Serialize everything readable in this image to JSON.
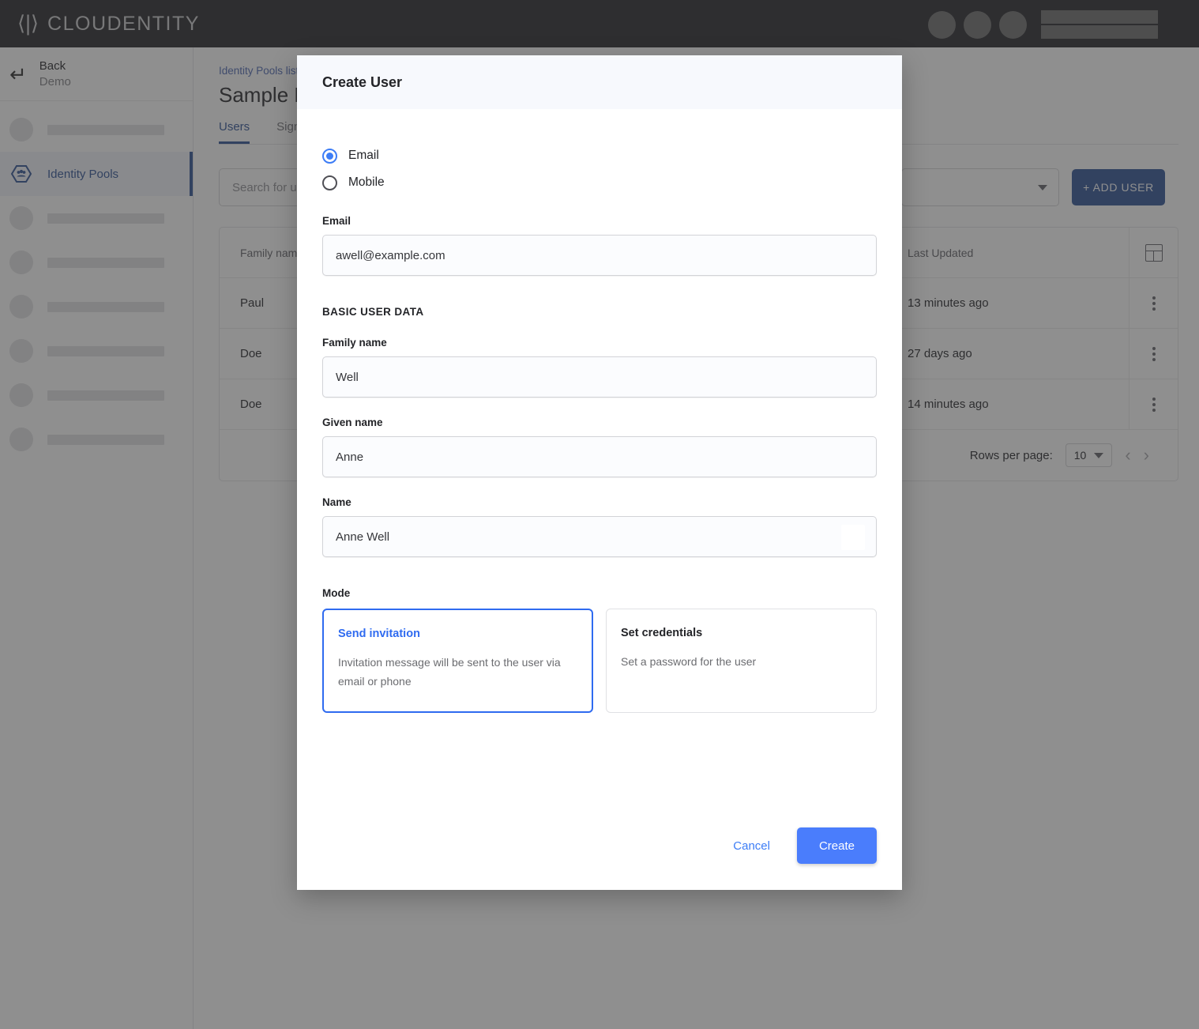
{
  "brand": {
    "logo_mark": "⟨|⟩",
    "logo_text": "CLOUDENTITY",
    "accent_blue": "#3d7df6",
    "nav_blue": "#3e5e9e",
    "topbar_bg": "#35363a"
  },
  "sidebar": {
    "back_label": "Back",
    "back_sublabel": "Demo",
    "back_icon": "back-arrow-icon",
    "active_item": {
      "label": "Identity Pools",
      "icon": "identity-pools-icon"
    },
    "redacted_items_above": 1,
    "redacted_items_below": 6
  },
  "main": {
    "breadcrumb": "Identity Pools list",
    "page_title": "Sample Po",
    "tabs": [
      {
        "label": "Users",
        "active": true
      },
      {
        "label": "Sign",
        "active": false
      }
    ],
    "search": {
      "placeholder": "Search for us"
    },
    "add_user_label": "+ ADD USER",
    "table": {
      "columns": [
        "Family name",
        "Last Updated"
      ],
      "rows": [
        {
          "family_name": "Paul",
          "last_updated": "13 minutes ago"
        },
        {
          "family_name": "Doe",
          "last_updated": "27 days ago"
        },
        {
          "family_name": "Doe",
          "last_updated": "14 minutes ago"
        }
      ],
      "column_settings_icon": "table-columns-icon",
      "row_menu_icon": "kebab-menu-icon"
    },
    "pagination": {
      "rows_per_page_label": "Rows per page:",
      "rows_per_page_value": "10",
      "prev_icon": "chevron-left-icon",
      "next_icon": "chevron-right-icon"
    }
  },
  "dialog": {
    "title": "Create User",
    "identifier_options": [
      {
        "label": "Email",
        "selected": true
      },
      {
        "label": "Mobile",
        "selected": false
      }
    ],
    "email": {
      "label": "Email",
      "value": "awell@example.com"
    },
    "section_header": "BASIC USER DATA",
    "fields": [
      {
        "label": "Family name",
        "value": "Well"
      },
      {
        "label": "Given name",
        "value": "Anne"
      },
      {
        "label": "Name",
        "value": "Anne Well"
      }
    ],
    "mode": {
      "label": "Mode",
      "cards": [
        {
          "title": "Send invitation",
          "description": "Invitation message will be sent to the user via email or phone",
          "selected": true
        },
        {
          "title": "Set credentials",
          "description": "Set a password for the user",
          "selected": false
        }
      ]
    },
    "cancel_label": "Cancel",
    "create_label": "Create"
  }
}
